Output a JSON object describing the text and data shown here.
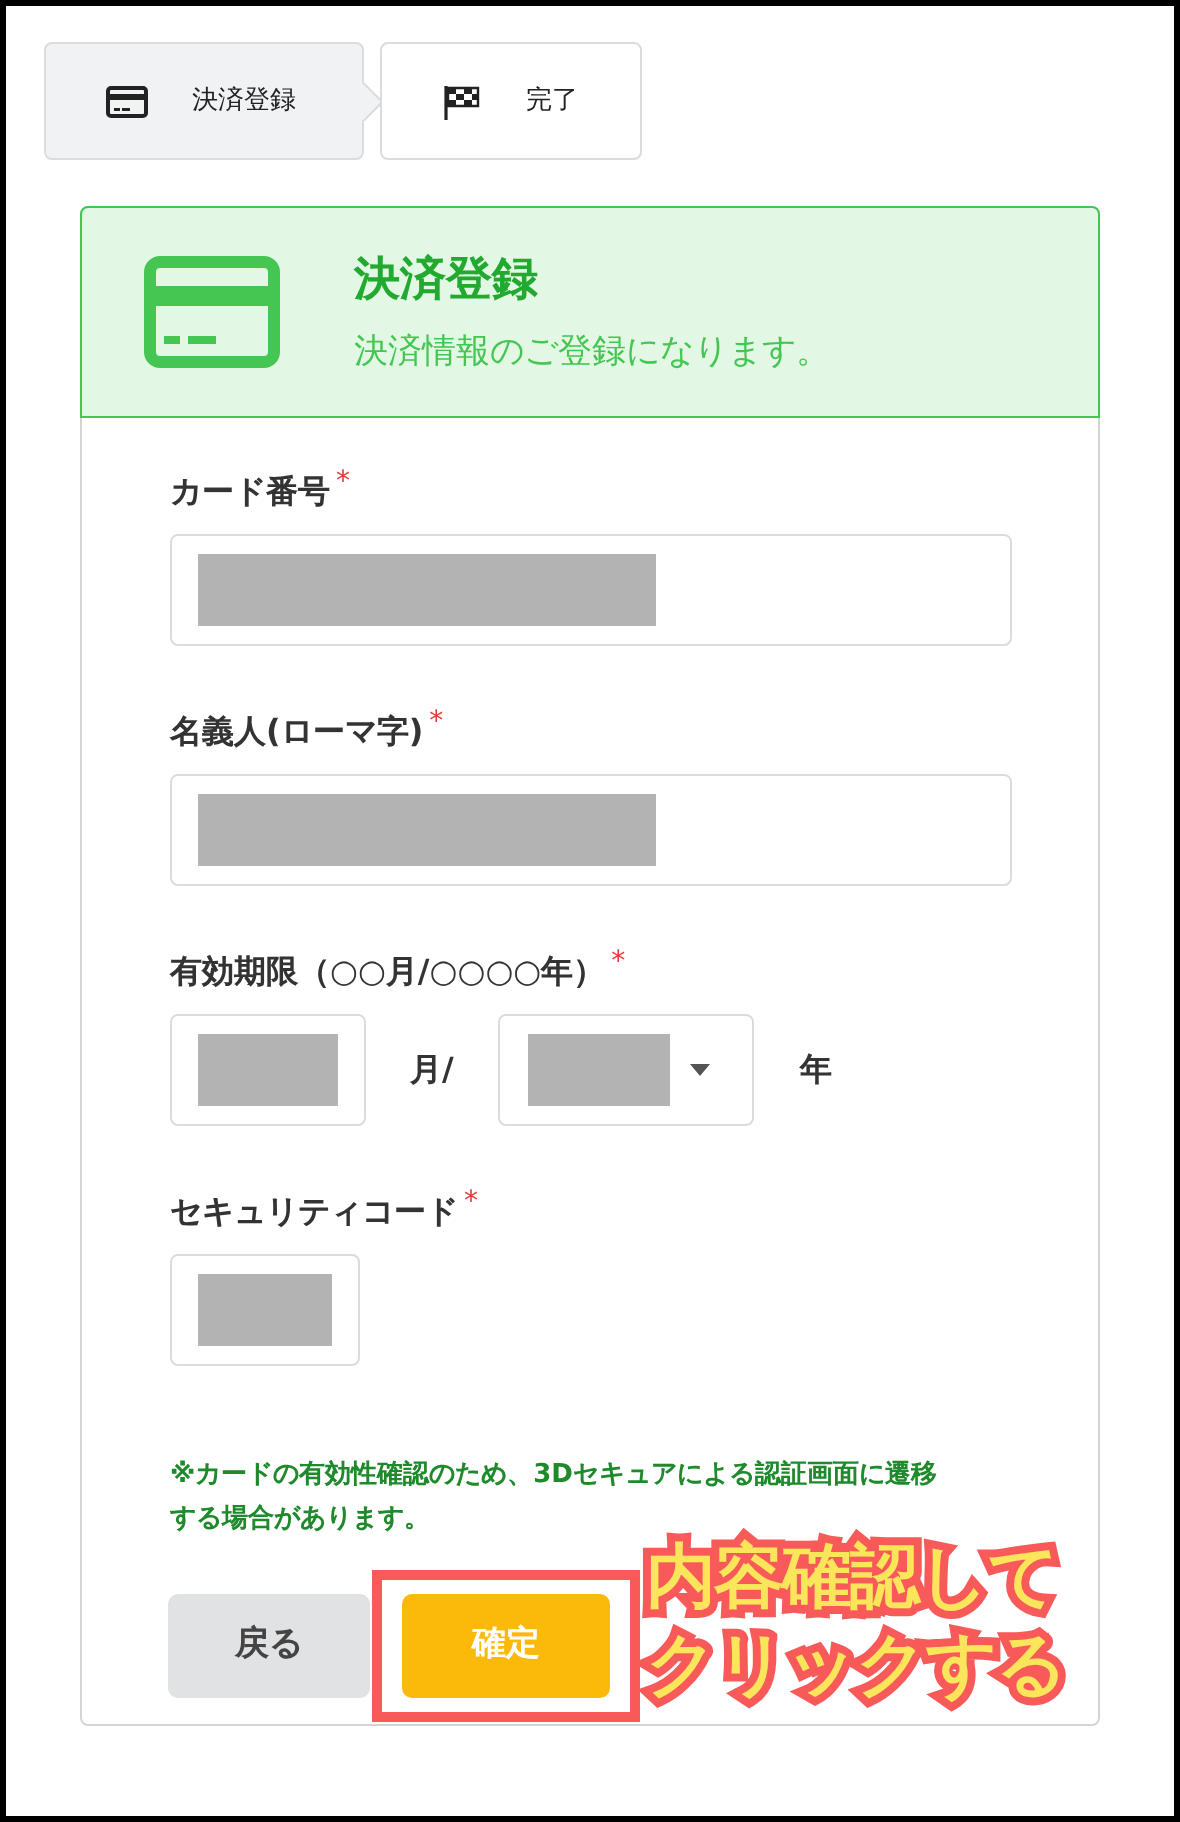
{
  "steps": [
    {
      "label": "決済登録",
      "selected": true
    },
    {
      "label": "完了",
      "selected": false
    }
  ],
  "header": {
    "title": "決済登録",
    "subtitle": "決済情報のご登録になります。"
  },
  "fields": [
    {
      "kind": "text",
      "label": "カード番号",
      "required_mark": "*"
    },
    {
      "kind": "text",
      "label": "名義人(ローマ字)",
      "required_mark": "*"
    },
    {
      "kind": "expiry",
      "label": "有効期限（○○月/○○○○年）",
      "required_mark": "*",
      "month_suffix": "月/",
      "year_suffix": "年"
    },
    {
      "kind": "code",
      "label": "セキュリティコード",
      "required_mark": "*"
    }
  ],
  "note": "※カードの有効性確認のため、3Dセキュアによる認証画面に遷移する場合があります。",
  "buttons": [
    {
      "kind": "secondary",
      "label": "戻る",
      "highlighted": false
    },
    {
      "kind": "primary",
      "label": "確定",
      "highlighted": true
    }
  ],
  "annotation": {
    "lines": [
      "内容確認して",
      "クリックする"
    ]
  }
}
